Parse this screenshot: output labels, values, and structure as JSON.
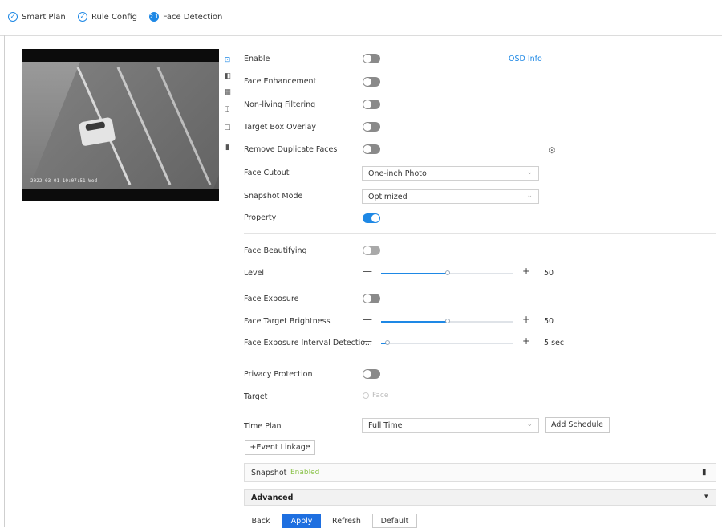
{
  "wizard": {
    "steps": [
      {
        "label": "Smart Plan",
        "marker": "check-icon"
      },
      {
        "label": "Rule Config",
        "marker": "check-icon"
      },
      {
        "label": "Face Detection",
        "marker": "2.1"
      }
    ]
  },
  "video": {
    "osd_text": "2022-03-01 10:07:51 Wed"
  },
  "form": {
    "enable_label": "Enable",
    "osd_info_link": "OSD Info",
    "face_enhancement_label": "Face Enhancement",
    "non_living_label": "Non-living Filtering",
    "target_box_label": "Target Box Overlay",
    "remove_duplicate_label": "Remove Duplicate Faces",
    "face_cutout_label": "Face Cutout",
    "face_cutout_value": "One-inch Photo",
    "snapshot_mode_label": "Snapshot Mode",
    "snapshot_mode_value": "Optimized",
    "property_label": "Property",
    "face_beautifying_label": "Face Beautifying",
    "level_label": "Level",
    "level_value": "50",
    "face_exposure_label": "Face Exposure",
    "target_brightness_label": "Face Target Brightness",
    "target_brightness_value": "50",
    "interval_label": "Face Exposure Interval Detectio...",
    "interval_value": "5 sec",
    "privacy_label": "Privacy Protection",
    "target_label": "Target",
    "target_option": "Face",
    "time_plan_label": "Time Plan",
    "time_plan_value": "Full Time",
    "add_schedule_button": "Add Schedule",
    "event_linkage_button": "+Event Linkage",
    "snapshot_label": "Snapshot",
    "snapshot_status": "Enabled",
    "advanced_label": "Advanced"
  },
  "sliders": {
    "level": 50,
    "brightness": 50,
    "interval": 5
  },
  "footer": {
    "back": "Back",
    "apply": "Apply",
    "refresh": "Refresh",
    "default": "Default"
  },
  "colors": {
    "accent": "#1e88e5",
    "enabled_text": "#8bc34a",
    "toggle_off": "#8a8a8a"
  }
}
